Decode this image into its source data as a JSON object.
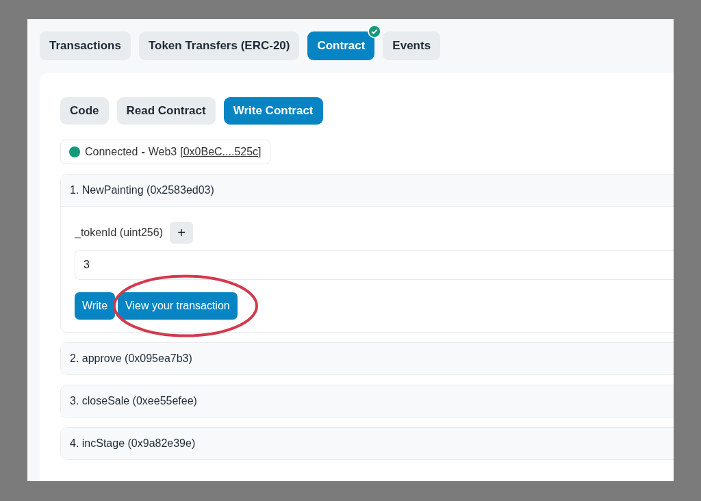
{
  "tabs": [
    {
      "label": "Transactions",
      "selected": false,
      "verified": false
    },
    {
      "label": "Token Transfers (ERC-20)",
      "selected": false,
      "verified": false
    },
    {
      "label": "Contract",
      "selected": true,
      "verified": true
    },
    {
      "label": "Events",
      "selected": false,
      "verified": false
    }
  ],
  "subtabs": [
    {
      "label": "Code",
      "selected": false
    },
    {
      "label": "Read Contract",
      "selected": false
    },
    {
      "label": "Write Contract",
      "selected": true
    }
  ],
  "connection": {
    "connected": true,
    "status": "Connected",
    "separator": "-",
    "provider": "Web3",
    "address": "[0x0BeC....525c]"
  },
  "functions": [
    {
      "title": "1. NewPainting (0x2583ed03)",
      "expanded": true,
      "inputs": [
        {
          "label": "_tokenId (uint256)",
          "add_button": "+",
          "value": "3"
        }
      ],
      "buttons": [
        {
          "label": "Write",
          "highlighted": false
        },
        {
          "label": "View your transaction",
          "highlighted": true
        }
      ]
    },
    {
      "title": "2. approve (0x095ea7b3)",
      "expanded": false
    },
    {
      "title": "3. closeSale (0xee55efee)",
      "expanded": false
    },
    {
      "title": "4. incStage (0x9a82e39e)",
      "expanded": false
    }
  ]
}
